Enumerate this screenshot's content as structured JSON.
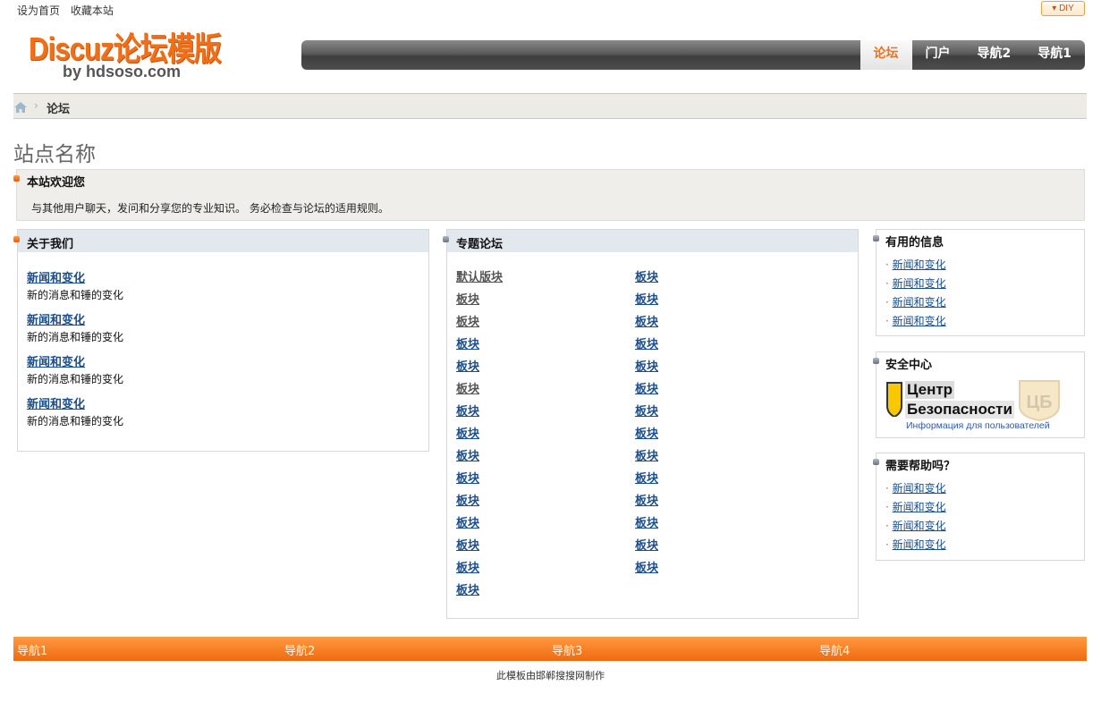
{
  "topbar": {
    "set_home": "设为首页",
    "bookmark": "收藏本站",
    "diy": "DIY"
  },
  "logo": {
    "line1": "Discuz论坛模版",
    "line2": "by hdsoso.com"
  },
  "nav": [
    {
      "label": "论坛",
      "active": true
    },
    {
      "label": "门户",
      "active": false
    },
    {
      "label": "导航2",
      "active": false
    },
    {
      "label": "导航1",
      "active": false
    }
  ],
  "breadcrumb": {
    "sep": "›",
    "current": "论坛"
  },
  "site_title": "站点名称",
  "welcome": {
    "heading": "本站欢迎您",
    "text": "与其他用户聊天，发问和分享您的专业知识。 务必检查与论坛的适用规则。"
  },
  "about": {
    "heading": "关于我们",
    "entries": [
      {
        "title": "新闻和变化",
        "desc": "新的消息和锤的变化"
      },
      {
        "title": "新闻和变化",
        "desc": "新的消息和锤的变化"
      },
      {
        "title": "新闻和变化",
        "desc": "新的消息和锤的变化"
      },
      {
        "title": "新闻和变化",
        "desc": "新的消息和锤的变化"
      }
    ]
  },
  "topics": {
    "heading": "专题论坛",
    "col1": [
      "默认版块",
      "板块",
      "板块",
      "板块",
      "板块",
      "板块",
      "板块",
      "板块",
      "板块",
      "板块",
      "板块",
      "板块",
      "板块",
      "板块",
      "板块"
    ],
    "col2": [
      "板块",
      "板块",
      "板块",
      "板块",
      "板块",
      "板块",
      "板块",
      "板块",
      "板块",
      "板块",
      "板块",
      "板块",
      "板块",
      "板块"
    ]
  },
  "useful": {
    "heading": "有用的信息",
    "items": [
      "新闻和变化",
      "新闻和变化",
      "新闻和变化",
      "新闻和变化"
    ]
  },
  "security": {
    "heading": "安全中心",
    "line1": "Центр",
    "line2": "Безопасности",
    "line3": "Информация для пользователей",
    "watermark": "ЦБ"
  },
  "help": {
    "heading": "需要帮助吗？",
    "items": [
      "新闻和变化",
      "新闻和变化",
      "新闻和变化",
      "新闻和变化"
    ]
  },
  "footer_nav": [
    "导航1",
    "导航2",
    "导航3",
    "导航4"
  ],
  "credit": "此模板由邯郸搜搜网制作",
  "colors": {
    "accent": "#f07018",
    "link": "#1a4e8c",
    "nav_dark": "#4e4e4e"
  }
}
